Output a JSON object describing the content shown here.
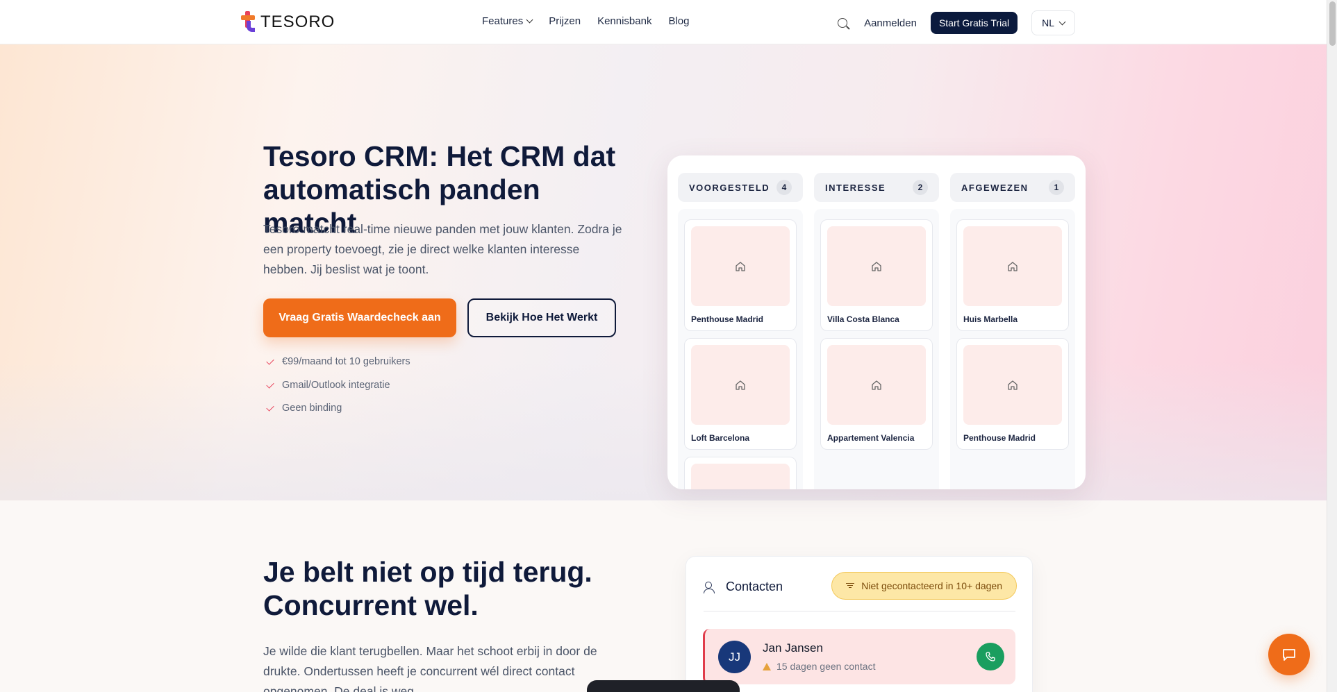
{
  "nav": {
    "logo_text": "TESORO",
    "links": [
      "Features",
      "Prijzen",
      "Kennisbank",
      "Blog"
    ],
    "login": "Aanmelden",
    "trial": "Start Gratis Trial",
    "language": "NL"
  },
  "hero": {
    "title": "Tesoro CRM: Het CRM dat automatisch panden matcht",
    "subtitle": "Tesoro matcht real-time nieuwe panden met jouw klanten. Zodra je een property toevoegt, zie je direct welke klanten interesse hebben. Jij beslist wat je toont.",
    "cta_primary": "Vraag Gratis Waardecheck aan",
    "cta_secondary": "Bekijk Hoe Het Werkt",
    "checks": [
      "€99/maand tot 10 gebruikers",
      "Gmail/Outlook integratie",
      "Geen binding"
    ]
  },
  "board": {
    "columns": [
      {
        "title": "VOORGESTELD",
        "count": "4",
        "cards": [
          "Penthouse Madrid",
          "Loft Barcelona",
          ""
        ]
      },
      {
        "title": "INTERESSE",
        "count": "2",
        "cards": [
          "Villa Costa Blanca",
          "Appartement Valencia"
        ]
      },
      {
        "title": "AFGEWEZEN",
        "count": "1",
        "cards": [
          "Huis Marbella",
          "Penthouse Madrid"
        ]
      }
    ]
  },
  "section2": {
    "title_line1": "Je belt niet op tijd terug.",
    "title_line2": "Concurrent wel.",
    "subtitle": "Je wilde die klant terugbellen. Maar het schoot erbij in door de drukte. Ondertussen heeft je concurrent wél direct contact opgenomen. De deal is weg."
  },
  "contacts": {
    "title": "Contacten",
    "filter": "Niet gecontacteerd in 10+ dagen",
    "rows": [
      {
        "initials": "JJ",
        "name": "Jan Jansen",
        "meta": "15 dagen geen contact"
      }
    ]
  },
  "colors": {
    "accent": "#ef6c19",
    "navy": "#0b1a3d",
    "danger": "#e03c4a",
    "success": "#1a9e5f"
  }
}
